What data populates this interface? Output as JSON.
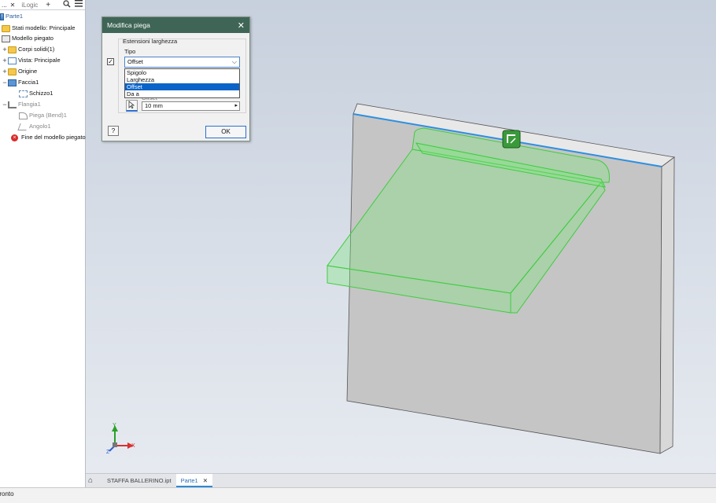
{
  "browser": {
    "tab_label": "...",
    "tab_close": "✕",
    "tab_logic": "iLogic",
    "add_tab": "+",
    "root": "Parte1",
    "items": [
      {
        "label": "Stati modello: Principale",
        "pm": "",
        "icon": "folder"
      },
      {
        "label": "Modello piegato",
        "pm": "",
        "icon": "sheet"
      },
      {
        "label": "Corpi solidi(1)",
        "pm": "+",
        "icon": "folder"
      },
      {
        "label": "Vista: Principale",
        "pm": "+",
        "icon": "view"
      },
      {
        "label": "Origine",
        "pm": "+",
        "icon": "folder"
      },
      {
        "label": "Faccia1",
        "pm": "−",
        "icon": "face"
      },
      {
        "label": "Schizzo1",
        "pm": "",
        "icon": "sketch"
      },
      {
        "label": "Flangia1",
        "pm": "−",
        "icon": "flange"
      },
      {
        "label": "Piega (Bend)1",
        "pm": "",
        "icon": "bend"
      },
      {
        "label": "Angolo1",
        "pm": "",
        "icon": "angle"
      },
      {
        "label": "Fine del modello piegato",
        "pm": "",
        "icon": "error"
      }
    ]
  },
  "dialog": {
    "title": "Modifica piega",
    "close": "✕",
    "group_label": "Estensioni larghezza",
    "type_label": "Tipo",
    "type_value": "Offset",
    "type_options": [
      "Spigolo",
      "Larghezza",
      "Offset",
      "Da a"
    ],
    "selected_option": "Offset",
    "offset_label": "Offset",
    "offset_value": "10 mm",
    "help": "?",
    "ok": "OK"
  },
  "doc_tabs": {
    "file_tab": "STAFFA BALLERINO.ipt",
    "part_tab": "Parte1",
    "part_tab_close": "✕"
  },
  "status_bar": {
    "text": "Pronto"
  },
  "axes": {
    "x": "X",
    "y": "Y",
    "z": "Z"
  },
  "colors": {
    "dialog_title_bg": "#3f6556",
    "selection_blue": "#0a64c8",
    "preview_green": "#5fe05f",
    "part_gray": "#c5c5c5"
  }
}
